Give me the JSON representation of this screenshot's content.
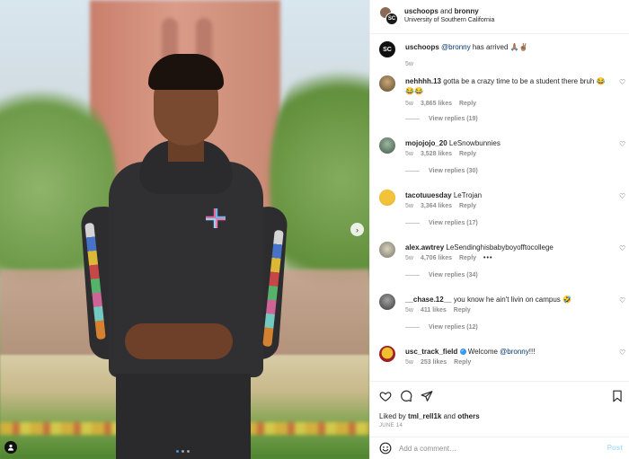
{
  "post": {
    "header": {
      "account1": "uschoops",
      "and": "and",
      "account2": "bronny",
      "location": "University of Southern California",
      "avatar2_mark": "SC"
    },
    "caption": {
      "username": "uschoops",
      "mention": "@bronny",
      "text": " has arrived 🙏🏽✌🏽",
      "time": "5w",
      "avatar_mark": "SC"
    },
    "comments": [
      {
        "username": "nehhhh.13",
        "text": "gotta be a crazy time to be a student there bruh 😂😂😂",
        "time": "5w",
        "likes": "3,865 likes",
        "reply": "Reply",
        "view_replies": "View replies (19)"
      },
      {
        "username": "mojojojo_20",
        "text": "LeSnowbunnies",
        "time": "5w",
        "likes": "3,528 likes",
        "reply": "Reply",
        "view_replies": "View replies (30)"
      },
      {
        "username": "tacotuuesday",
        "text": "LeTrojan",
        "time": "5w",
        "likes": "3,364 likes",
        "reply": "Reply",
        "view_replies": "View replies (17)"
      },
      {
        "username": "alex.awtrey",
        "text": "LeSendinghisbabyboyofftocollege",
        "time": "5w",
        "likes": "4,706 likes",
        "reply": "Reply",
        "more": "•••",
        "view_replies": "View replies (34)"
      },
      {
        "username": "__chase.12__",
        "text": "you know he ain't livin on campus 🤣",
        "time": "5w",
        "likes": "411 likes",
        "reply": "Reply",
        "view_replies": "View replies (12)"
      },
      {
        "username": "usc_track_field",
        "text_before": "Welcome ",
        "mention": "@bronny",
        "text_after": "!!!",
        "time": "5w",
        "likes": "253 likes",
        "reply": "Reply"
      }
    ],
    "liked_by": {
      "prefix": "Liked by ",
      "user": "tml_rell1k",
      "middle": " and ",
      "others": "others"
    },
    "date": "JUNE 14",
    "add_comment": {
      "placeholder": "Add a comment…",
      "post_label": "Post"
    }
  },
  "icons": {
    "like": "heart-icon",
    "comment": "comment-icon",
    "share": "paper-plane-icon",
    "save": "bookmark-icon",
    "emoji": "smiley-icon",
    "next": "chevron-right-icon",
    "tag": "user-tag-icon"
  },
  "colors": {
    "link": "#00376b",
    "verified": "#3897f0",
    "muted": "#8e8e8e",
    "post_disabled": "#b2dffc"
  }
}
